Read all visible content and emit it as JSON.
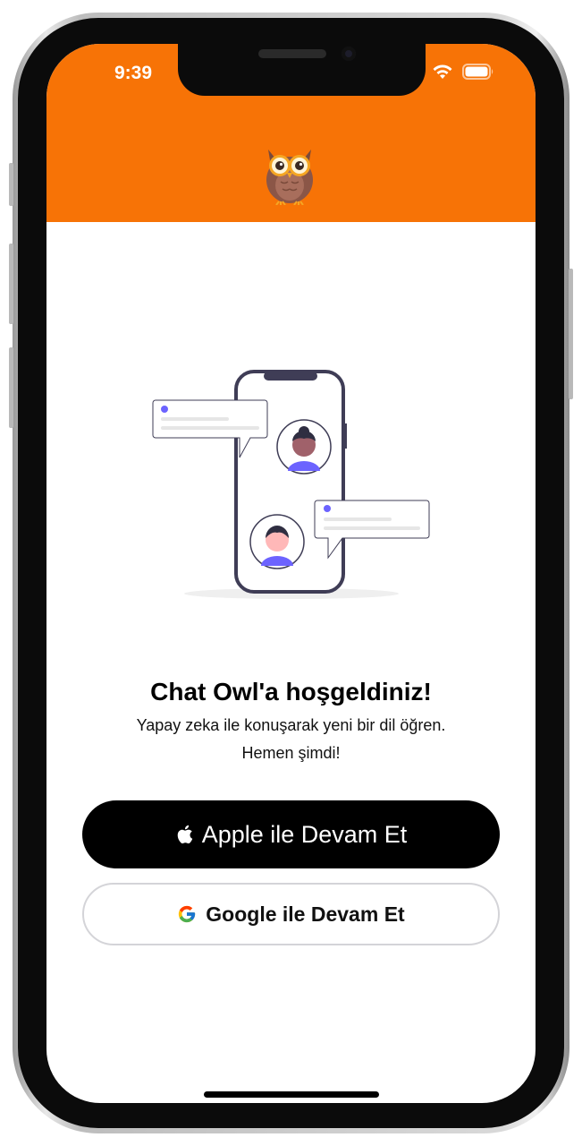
{
  "status_bar": {
    "time": "9:39",
    "icons": [
      "wifi-icon",
      "battery-icon"
    ]
  },
  "header": {
    "background_color": "#f77306",
    "logo": "owl-logo"
  },
  "illustration": {
    "name": "phone-chat-illustration",
    "accent_color": "#6c63ff"
  },
  "welcome": {
    "title": "Chat Owl'a hoşgeldiniz!",
    "subtitle_line1": "Yapay zeka ile konuşarak yeni bir dil öğren.",
    "subtitle_line2": "Hemen şimdi!"
  },
  "buttons": {
    "apple_label": "Apple ile Devam Et",
    "apple_icon": "apple-icon",
    "google_label": "Google ile Devam Et",
    "google_icon": "google-icon"
  }
}
